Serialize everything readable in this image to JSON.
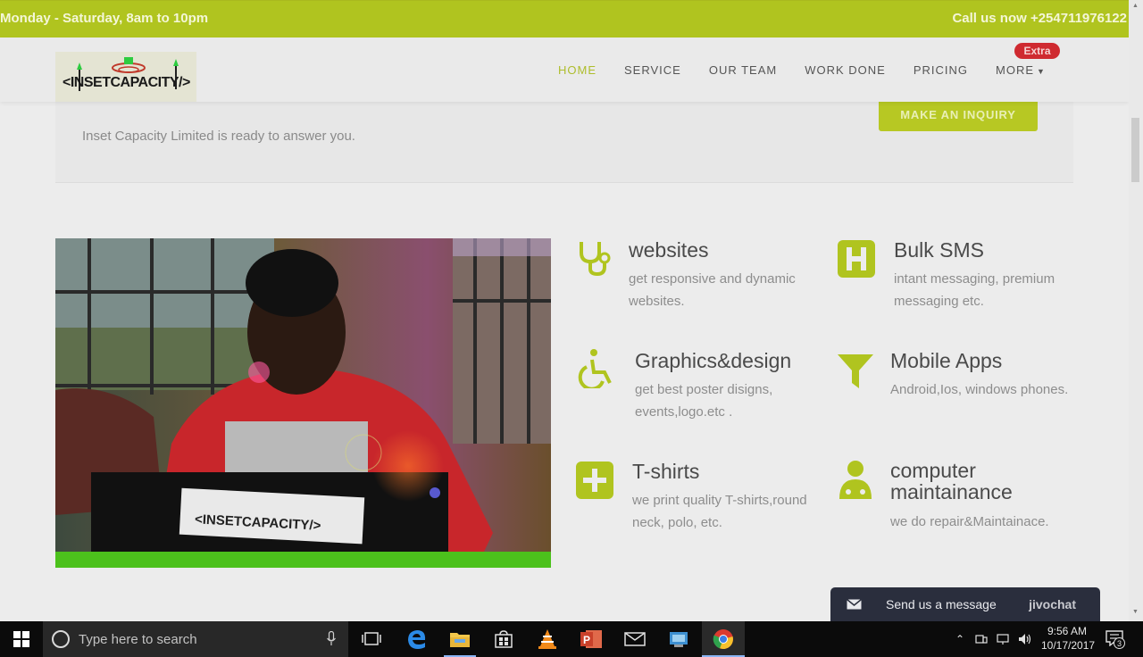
{
  "topbar": {
    "hours": "Monday - Saturday, 8am to 10pm",
    "phone": "Call us now +254711976122"
  },
  "inquiry": {
    "subtitle": "Inset Capacity Limited is ready to answer you.",
    "button": "MAKE AN INQUIRY"
  },
  "header": {
    "logo_text": "<INSETCAPACITY/>",
    "nav": [
      {
        "label": "HOME",
        "active": true
      },
      {
        "label": "SERVICE"
      },
      {
        "label": "OUR TEAM"
      },
      {
        "label": "WORK DONE"
      },
      {
        "label": "PRICING"
      },
      {
        "label": "MORE"
      }
    ],
    "extra_badge": "Extra"
  },
  "photo": {
    "laptop_logo_text": "<INSETCAPACITY/>",
    "description_icon": "person-at-laptop-photo"
  },
  "services": [
    {
      "title": "websites",
      "desc": "get responsive and dynamic websites.",
      "icon": "stethoscope-icon"
    },
    {
      "title": "Bulk SMS",
      "desc": "intant messaging, premium messaging etc.",
      "icon": "hospital-sign-icon"
    },
    {
      "title": "Graphics&design",
      "desc": "get best poster disigns, events,logo.etc .",
      "icon": "wheelchair-icon"
    },
    {
      "title": "Mobile Apps",
      "desc": "Android,Ios, windows phones.",
      "icon": "filter-icon"
    },
    {
      "title": "T-shirts",
      "desc": "we print quality T-shirts,round neck, polo, etc.",
      "icon": "plus-square-icon"
    },
    {
      "title": "computer maintainance",
      "desc": "we do repair&Maintainace.",
      "icon": "user-doctor-icon"
    }
  ],
  "chat": {
    "message": "Send us a message",
    "brand": "jivochat"
  },
  "taskbar": {
    "search_placeholder": "Type here to search",
    "time": "9:56 AM",
    "date": "10/17/2017",
    "notifications": "3"
  },
  "colors": {
    "accent": "#b0c41f",
    "photo_bar": "#4cc11c",
    "badge": "#cf2a30",
    "chat_bg": "#2a2e3d"
  }
}
